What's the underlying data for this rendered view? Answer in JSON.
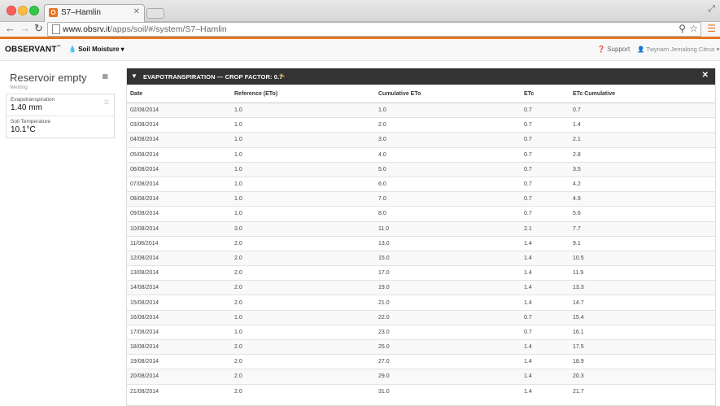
{
  "browser": {
    "tab_title": "S7–Hamlin",
    "tab_favicon": "O",
    "url_domain": "www.obsrv.it",
    "url_path": "/apps/soil/#/system/S7–Hamlin"
  },
  "app": {
    "logo": "OBSERVANT",
    "logo_tm": "™",
    "nav_dropdown": "Soil Moisture",
    "support_label": "Support",
    "user_label": "Twynam Jemalong Citrus"
  },
  "sidebar": {
    "title": "Reservoir empty",
    "subtitle": "Wetting",
    "metrics": [
      {
        "label": "Evapotranspiration",
        "value": "1.40 mm"
      },
      {
        "label": "Soil Temperature",
        "value": "10.1°C"
      }
    ]
  },
  "panel": {
    "title": "EVAPOTRANSPIRATION — CROP FACTOR: 0.7",
    "columns": [
      "Date",
      "Reference (ETo)",
      "Cumulative ETo",
      "ETc",
      "ETc Cumulative"
    ],
    "rows": [
      [
        "02/08/2014",
        "1.0",
        "1.0",
        "0.7",
        "0.7"
      ],
      [
        "03/08/2014",
        "1.0",
        "2.0",
        "0.7",
        "1.4"
      ],
      [
        "04/08/2014",
        "1.0",
        "3.0",
        "0.7",
        "2.1"
      ],
      [
        "05/08/2014",
        "1.0",
        "4.0",
        "0.7",
        "2.8"
      ],
      [
        "06/08/2014",
        "1.0",
        "5.0",
        "0.7",
        "3.5"
      ],
      [
        "07/08/2014",
        "1.0",
        "6.0",
        "0.7",
        "4.2"
      ],
      [
        "08/08/2014",
        "1.0",
        "7.0",
        "0.7",
        "4.9"
      ],
      [
        "09/08/2014",
        "1.0",
        "8.0",
        "0.7",
        "5.6"
      ],
      [
        "10/08/2014",
        "3.0",
        "11.0",
        "2.1",
        "7.7"
      ],
      [
        "11/08/2014",
        "2.0",
        "13.0",
        "1.4",
        "9.1"
      ],
      [
        "12/08/2014",
        "2.0",
        "15.0",
        "1.4",
        "10.5"
      ],
      [
        "13/08/2014",
        "2.0",
        "17.0",
        "1.4",
        "11.9"
      ],
      [
        "14/08/2014",
        "2.0",
        "19.0",
        "1.4",
        "13.3"
      ],
      [
        "15/08/2014",
        "2.0",
        "21.0",
        "1.4",
        "14.7"
      ],
      [
        "16/08/2014",
        "1.0",
        "22.0",
        "0.7",
        "15.4"
      ],
      [
        "17/08/2014",
        "1.0",
        "23.0",
        "0.7",
        "16.1"
      ],
      [
        "18/08/2014",
        "2.0",
        "25.0",
        "1.4",
        "17.5"
      ],
      [
        "19/08/2014",
        "2.0",
        "27.0",
        "1.4",
        "18.9"
      ],
      [
        "20/08/2014",
        "2.0",
        "29.0",
        "1.4",
        "20.3"
      ],
      [
        "21/08/2014",
        "2.0",
        "31.0",
        "1.4",
        "21.7"
      ]
    ]
  }
}
